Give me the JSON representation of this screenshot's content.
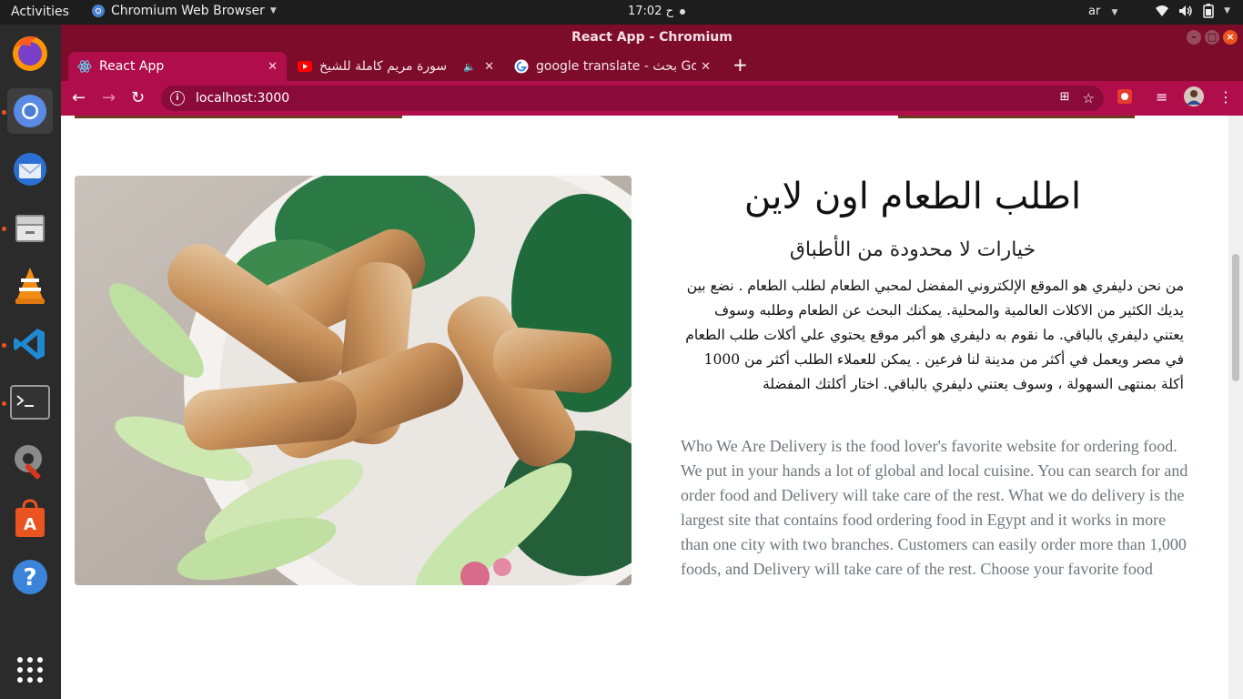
{
  "topbar": {
    "activities": "Activities",
    "app_name": "Chromium Web Browser",
    "clock": "ح 17:02",
    "language": "ar"
  },
  "dock": {
    "items": [
      "Firefox",
      "Chromium",
      "Thunderbird",
      "Files",
      "VLC",
      "Visual Studio Code",
      "Terminal",
      "Settings",
      "Ubuntu Software",
      "Help",
      "Show Applications"
    ]
  },
  "window": {
    "title": "React App - Chromium"
  },
  "tabs": [
    {
      "title": "React App",
      "icon": "react-icon"
    },
    {
      "title": "سورة مريم كاملة للشيخ",
      "icon": "youtube-icon"
    },
    {
      "title": "google translate - بحث Go",
      "icon": "google-icon"
    }
  ],
  "toolbar": {
    "url": "localhost:3000"
  },
  "content": {
    "heading": "اطلب الطعام اون لاين",
    "subheading": "خيارات لا محدودة من الأطباق",
    "arabic_paragraph": "من نحن دليفري هو الموقع الإلكتروني المفضل لمحبي الطعام لطلب الطعام . نضع بين يديك الكثير من الاكلات العالمية والمحلية. يمكنك البحث عن الطعام وطلبه وسوف يعتني دليفري بالباقي. ما نقوم به دليفري هو أكبر موقع يحتوي علي أكلات طلب الطعام في مصر ويعمل في أكثر من مدينة لنا فرعين . يمكن للعملاء الطلب أكثر من 1000 أكلة بمنتهى السهولة ، وسوف يعتني دليفري بالباقي. اختار أكلتك المفضلة",
    "english_paragraph": "Who We Are Delivery is the food lover's favorite website for ordering food. We put in your hands a lot of global and local cuisine. You can search for and order food and Delivery will take care of the rest. What we do delivery is the largest site that contains food ordering food in Egypt and it works in more than one city with two branches. Customers can easily order more than 1,000 foods, and Delivery will take care of the rest. Choose your favorite food"
  },
  "colors": {
    "titlebar": "#7d0c2b",
    "toolbar": "#b00e4b",
    "ubuntu_accent": "#e95420",
    "english_text": "#6c757d"
  }
}
